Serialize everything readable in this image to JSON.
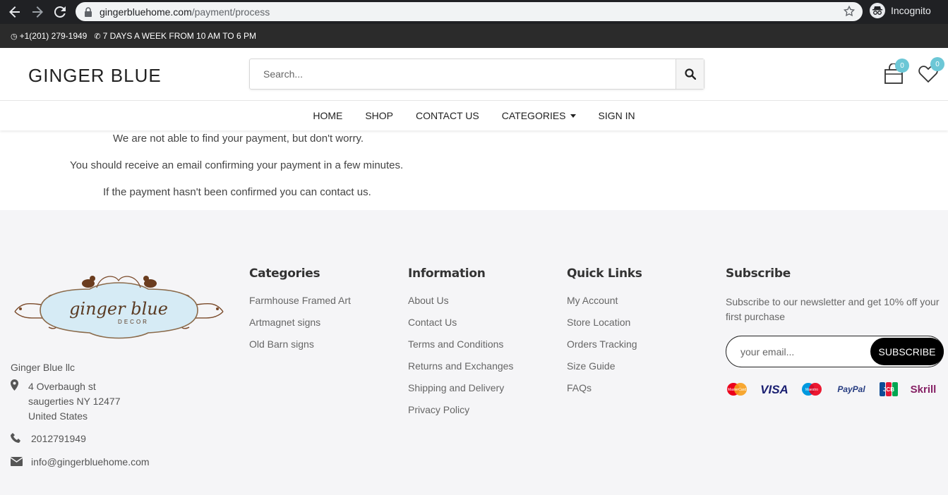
{
  "browser": {
    "url_host": "gingerbluehome.com",
    "url_path": "/payment/process",
    "profile_label": "Incognito"
  },
  "topbar": {
    "phone": "+1(201) 279-1949",
    "hours": "7 DAYS A WEEK FROM 10 AM TO 6 PM"
  },
  "header": {
    "logo": "GINGER BLUE",
    "search_placeholder": "Search...",
    "cart_count": "0",
    "wishlist_count": "0"
  },
  "nav": {
    "items": [
      "HOME",
      "SHOP",
      "CONTACT US",
      "CATEGORIES",
      "SIGN IN"
    ]
  },
  "message": {
    "line1": "We are not able to find your payment, but don't worry.",
    "line2": "You should receive an email confirming your payment in a few minutes.",
    "line3": "If the payment hasn't been confirmed you can contact us."
  },
  "footer": {
    "logo_main": "ginger blue",
    "logo_sub": "DECOR",
    "company": "Ginger Blue llc",
    "address": [
      "4 Overbaugh st",
      "saugerties NY 12477",
      "United States"
    ],
    "phone": "2012791949",
    "email": "info@gingerbluehome.com",
    "categories": {
      "title": "Categories",
      "items": [
        "Farmhouse Framed Art",
        "Artmagnet signs",
        "Old Barn signs"
      ]
    },
    "information": {
      "title": "Information",
      "items": [
        "About Us",
        "Contact Us",
        "Terms and Conditions",
        "Returns and Exchanges",
        "Shipping and Delivery",
        "Privacy Policy"
      ]
    },
    "quick_links": {
      "title": "Quick Links",
      "items": [
        "My Account",
        "Store Location",
        "Orders Tracking",
        "Size Guide",
        "FAQs"
      ]
    },
    "subscribe": {
      "title": "Subscribe",
      "text": "Subscribe to our newsletter and get 10% off your first purchase",
      "placeholder": "your email...",
      "button": "SUBSCRIBE",
      "payment_labels": {
        "mastercard": "MasterCard",
        "visa": "VISA",
        "maestro": "Maestro",
        "paypal": "PayPal",
        "jcb": "JCB",
        "skrill": "Skrill"
      }
    }
  },
  "colors": {
    "badge": "#6cc7d6",
    "topbar": "#2b2b2b",
    "footer_bg": "#f5f5f7"
  }
}
